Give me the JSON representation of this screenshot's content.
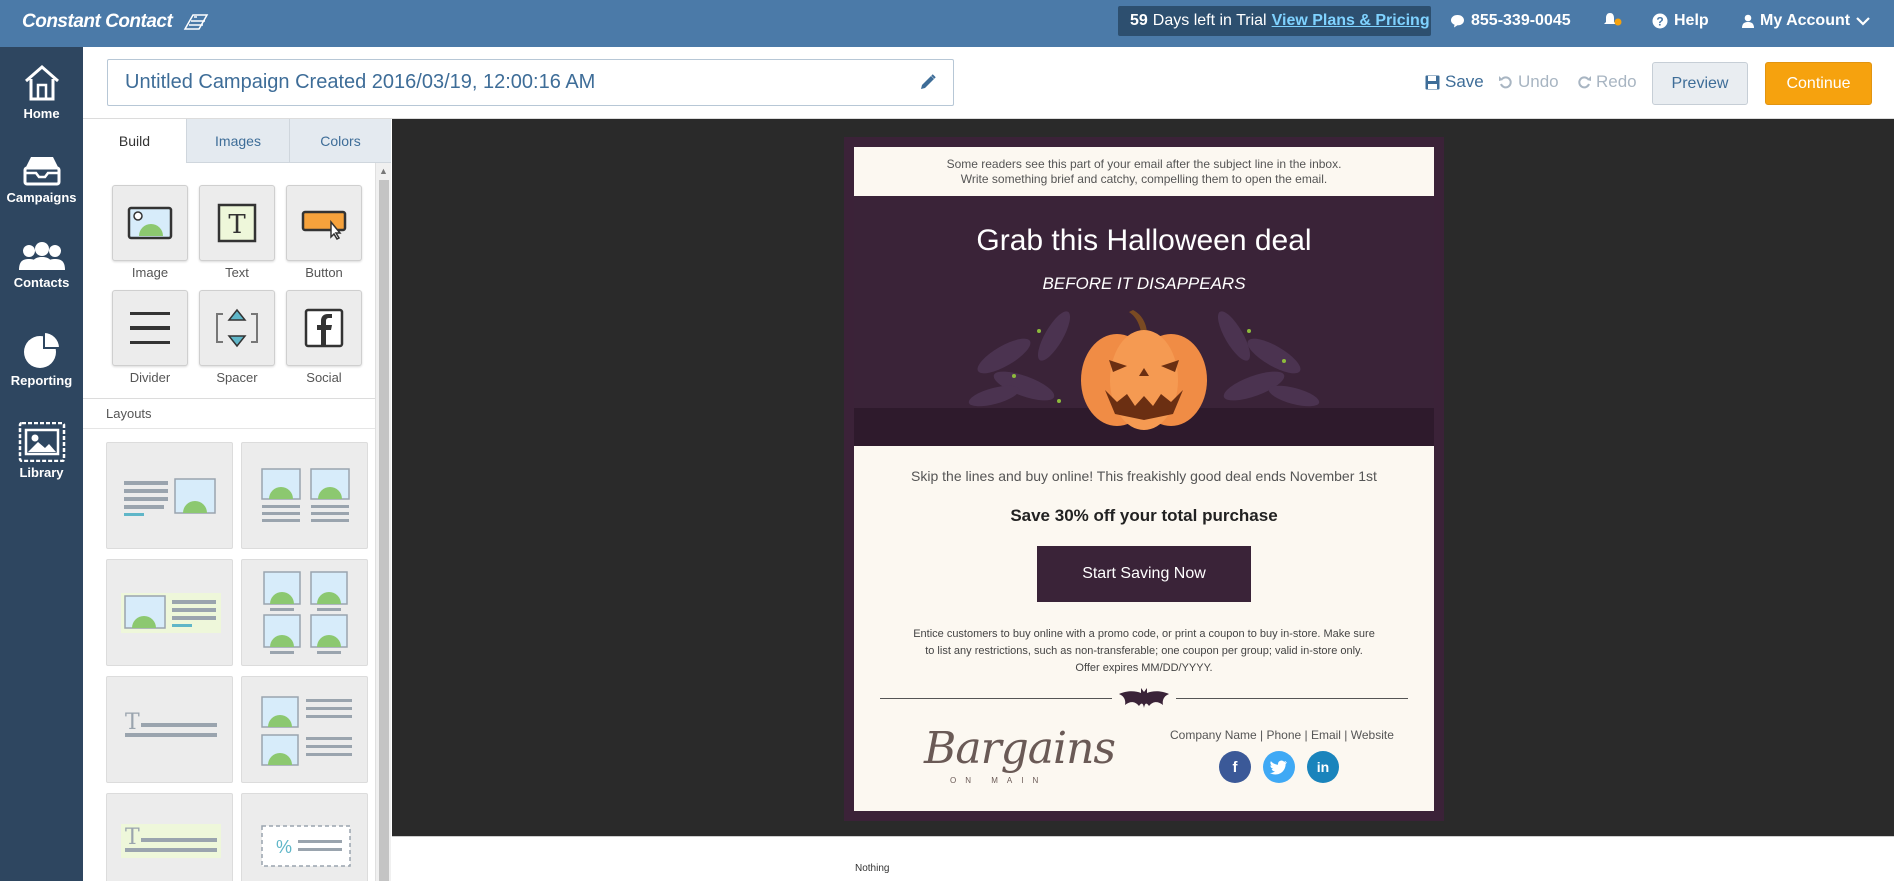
{
  "topbar": {
    "logo": "Constant Contact",
    "trial_days": "59",
    "trial_text": "Days left in Trial",
    "plans_link": "View Plans & Pricing",
    "phone": "855-339-0045",
    "help": "Help",
    "account": "My Account"
  },
  "nav": {
    "home": "Home",
    "campaigns": "Campaigns",
    "contacts": "Contacts",
    "reporting": "Reporting",
    "library": "Library"
  },
  "header": {
    "campaign_title": "Untitled Campaign Created 2016/03/19, 12:00:16 AM",
    "save": "Save",
    "undo": "Undo",
    "redo": "Redo",
    "preview": "Preview",
    "continue": "Continue"
  },
  "panel": {
    "tabs": [
      "Build",
      "Images",
      "Colors"
    ],
    "tools": [
      "Image",
      "Text",
      "Button",
      "Divider",
      "Spacer",
      "Social"
    ],
    "layouts_title": "Layouts"
  },
  "email": {
    "preheader_line1": "Some readers see this part of your email after the subject line in the inbox.",
    "preheader_line2": "Write something brief and catchy, compelling them to open the email.",
    "hero_title": "Grab this Halloween deal",
    "hero_subtitle": "BEFORE IT DISAPPEARS",
    "intro": "Skip the lines and buy online! This freakishly good deal ends November 1st",
    "offer": "Save 30% off your total purchase",
    "cta": "Start Saving Now",
    "fine_line1": "Entice customers to buy online with a promo code, or print a coupon to buy in-store. Make sure",
    "fine_line2": "to list any restrictions, such as non-transferable; one coupon per group; valid in-store only.",
    "fine_line3": "Offer expires MM/DD/YYYY.",
    "brand": "Bargains",
    "brand_sub": "ON MAIN",
    "company_line": "Company Name | Phone | Email | Website"
  },
  "canvas_footer": "Nothing",
  "colors": {
    "topbar": "#4b7aa8",
    "leftnav": "#2e4660",
    "accent": "#f6a20e",
    "email_purple": "#3a2338"
  }
}
